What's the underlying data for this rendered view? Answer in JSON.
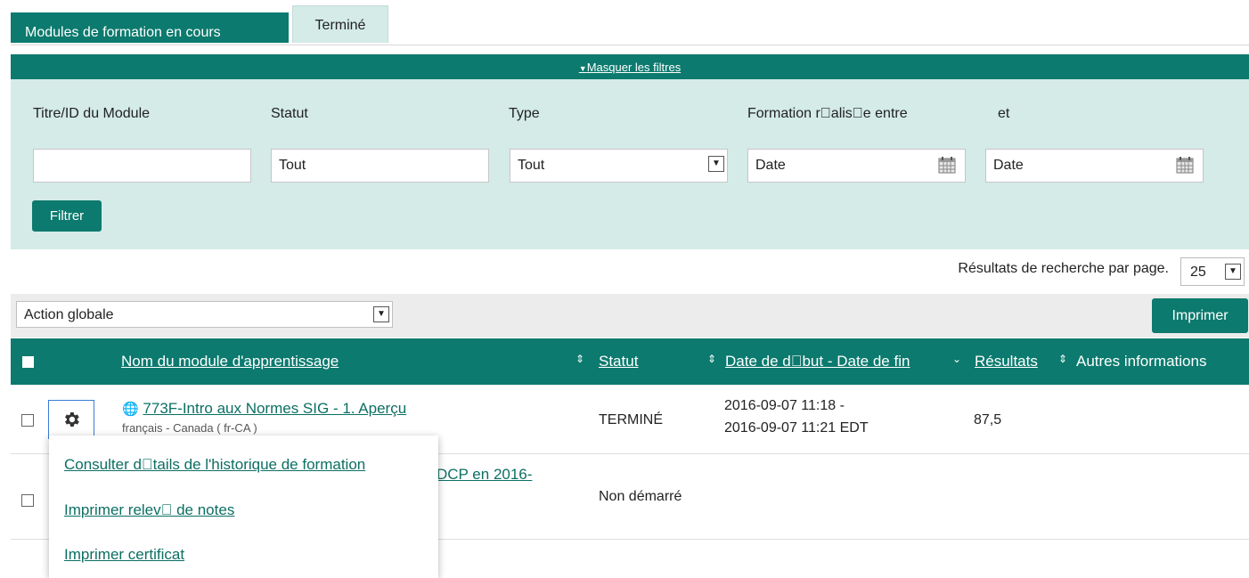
{
  "tabs": {
    "in_progress": "Modules de formation en cours",
    "completed": "Terminé"
  },
  "filters": {
    "toggle_label": "Masquer les filtres",
    "title_label": "Titre/ID du Module",
    "title_value": "",
    "status_label": "Statut",
    "status_value": "Tout",
    "type_label": "Type",
    "type_value": "Tout",
    "date_range_label": "Formation r\u0000alis\u0000e entre",
    "date_and_label": "et",
    "date_from_placeholder": "Date",
    "date_to_placeholder": "Date",
    "filter_button": "Filtrer"
  },
  "pagination": {
    "per_page_label": "Résultats de recherche par page.",
    "per_page_value": "25"
  },
  "actions": {
    "global_action": "Action globale",
    "print_button": "Imprimer"
  },
  "table": {
    "headers": {
      "name": "Nom du module d'apprentissage",
      "status": "Statut",
      "dates": "Date de d\u0000but - Date de fin",
      "results": "Résultats",
      "other": "Autres informations"
    },
    "rows": [
      {
        "title": "773F-Intro aux Normes SIG - 1. Aperçu",
        "language": "français - Canada ( fr-CA )",
        "status": "TERMINÉ",
        "date_start": "2016-09-07 11:18 -",
        "date_end": "2016-09-07 11:21 EDT",
        "result": "87,5"
      },
      {
        "title_fragment": "DCP en 2016-",
        "status": "Non démarré"
      }
    ]
  },
  "context_menu": {
    "items": [
      "Consulter d\u0000tails de l'historique de formation",
      "Imprimer relev\u0000 de notes",
      "Imprimer certificat"
    ]
  },
  "colors": {
    "primary": "#0c7a6e",
    "panel": "#d4ebe8",
    "link": "#0c6f63"
  }
}
